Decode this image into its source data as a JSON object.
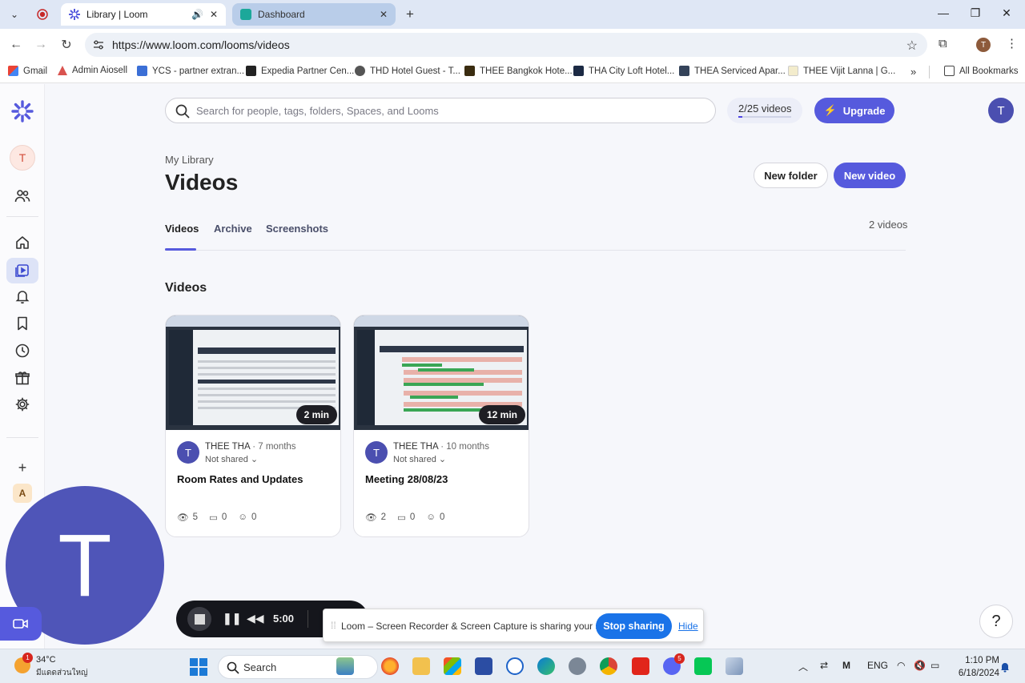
{
  "browser": {
    "tabs": [
      {
        "title": "Library | Loom",
        "active": true
      },
      {
        "title": "Dashboard",
        "active": false
      }
    ],
    "url": "https://www.loom.com/looms/videos",
    "bookmarks": [
      "Gmail",
      "Admin Aiosell",
      "YCS - partner extran...",
      "Expedia Partner Cen...",
      "THD Hotel Guest - T...",
      "THEE Bangkok Hote...",
      "THA City Loft Hotel...",
      "THEA Serviced Apar...",
      "THEE Vijit Lanna | G..."
    ],
    "all_bookmarks": "All Bookmarks",
    "profile_initial": "T"
  },
  "sidebar": {
    "avatar_initial": "T",
    "workspace_initial": "A",
    "add": "+"
  },
  "header": {
    "search_placeholder": "Search for people, tags, folders, Spaces, and Looms",
    "quota": "2/25 videos",
    "quota_fraction": 0.08,
    "upgrade": "Upgrade",
    "user_initial": "T"
  },
  "page": {
    "breadcrumb": "My Library",
    "title": "Videos",
    "new_folder": "New folder",
    "new_video": "New video",
    "tabs": [
      "Videos",
      "Archive",
      "Screenshots"
    ],
    "count": "2 videos",
    "section": "Videos"
  },
  "videos": [
    {
      "duration": "2 min",
      "avatar": "T",
      "owner": "THEE THA",
      "ago": "· 7 months",
      "share": "Not shared",
      "title": "Room Rates and Updates",
      "views": "5",
      "comments": "0",
      "reactions": "0"
    },
    {
      "duration": "12 min",
      "avatar": "T",
      "owner": "THEE THA",
      "ago": "· 10 months",
      "share": "Not shared",
      "title": "Meeting 28/08/23",
      "views": "2",
      "comments": "0",
      "reactions": "0"
    }
  ],
  "recorder": {
    "camera_initial": "T",
    "time": "5:00"
  },
  "share_bar": {
    "message": "Loom – Screen Recorder & Screen Capture is sharing your screen.",
    "stop": "Stop sharing",
    "hide": "Hide"
  },
  "help": "?",
  "taskbar": {
    "weather_badge": "1",
    "temperature": "34°C",
    "condition": "มีแดดส่วนใหญ่",
    "search": "Search",
    "discord_badge": "5",
    "language": "ENG",
    "time": "1:10 PM",
    "date": "6/18/2024"
  },
  "colors": {
    "accent": "#565add",
    "avatar": "#4b4fb0",
    "camera": "#4f55b8"
  }
}
